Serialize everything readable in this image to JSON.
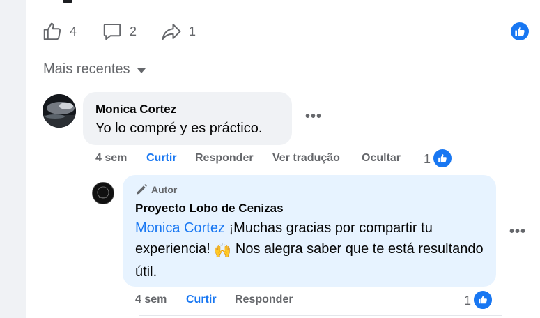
{
  "actions": {
    "like_count": "4",
    "comment_count": "2",
    "share_count": "1"
  },
  "sort": {
    "label": "Mais recentes"
  },
  "comments": [
    {
      "author": "Monica Cortez",
      "text": "Yo lo compré y es práctico.",
      "time": "4 sem",
      "like": "Curtir",
      "reply": "Responder",
      "translate": "Ver tradução",
      "hide": "Ocultar",
      "reactions": "1"
    }
  ],
  "reply": {
    "badge": "Autor",
    "author": "Proyecto Lobo de Cenizas",
    "mention": "Monica Cortez",
    "text": " ¡Muchas gracias por compartir tu experiencia! ",
    "emoji": "🙌",
    "text_after": " Nos alegra saber que te está resultando útil.",
    "time": "4 sem",
    "like": "Curtir",
    "reply": "Responder",
    "reactions": "1"
  },
  "colors": {
    "accent": "#1877f2",
    "secondary_text": "#65676b",
    "bubble": "#f0f2f5",
    "author_bubble": "#e7f3ff"
  }
}
